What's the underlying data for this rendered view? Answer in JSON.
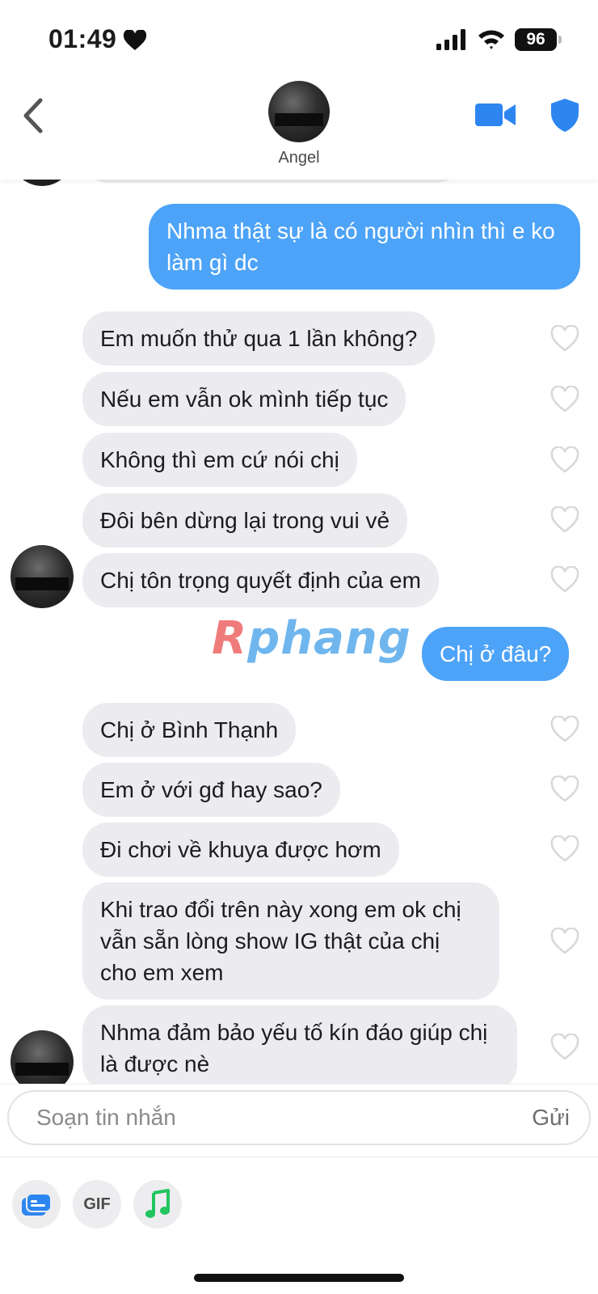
{
  "status_bar": {
    "time": "01:49",
    "battery": "96"
  },
  "header": {
    "contact_name": "Angel"
  },
  "messages": [
    {
      "text": "Nhma thật sự là có người nhìn thì e ko làm gì dc"
    },
    {
      "text": "Em muốn thử qua 1 lần không?"
    },
    {
      "text": "Nếu em vẫn ok mình tiếp tục"
    },
    {
      "text": "Không thì em cứ nói chị"
    },
    {
      "text": "Đôi bên dừng lại trong vui vẻ"
    },
    {
      "text": "Chị tôn trọng quyết định của em"
    },
    {
      "text": "Chị ở đâu?"
    },
    {
      "text": "Chị ở Bình Thạnh"
    },
    {
      "text": "Em ở với gđ hay sao?"
    },
    {
      "text": "Đi chơi về khuya được hơm"
    },
    {
      "text": "Khi trao đổi trên này xong em ok chị vẫn sẵn lòng show IG thật của chị cho em xem"
    },
    {
      "text": "Nhma đảm bảo yếu tố kín đáo giúp chị là được nè"
    }
  ],
  "watermark": {
    "first": "R",
    "rest": "phang"
  },
  "composer": {
    "placeholder": "Soạn tin nhắn",
    "send_label": "Gửi"
  },
  "toolbar": {
    "gif_label": "GIF"
  },
  "colors": {
    "accent": "#4da3f7",
    "incoming_bubble": "#ececf0",
    "icon_blue": "#2d86f0"
  },
  "icons": [
    "heart-icon",
    "signal-icon",
    "wifi-icon",
    "back-icon",
    "video-call-icon",
    "shield-icon",
    "like-heart-icon",
    "sticker-icon",
    "music-icon"
  ]
}
